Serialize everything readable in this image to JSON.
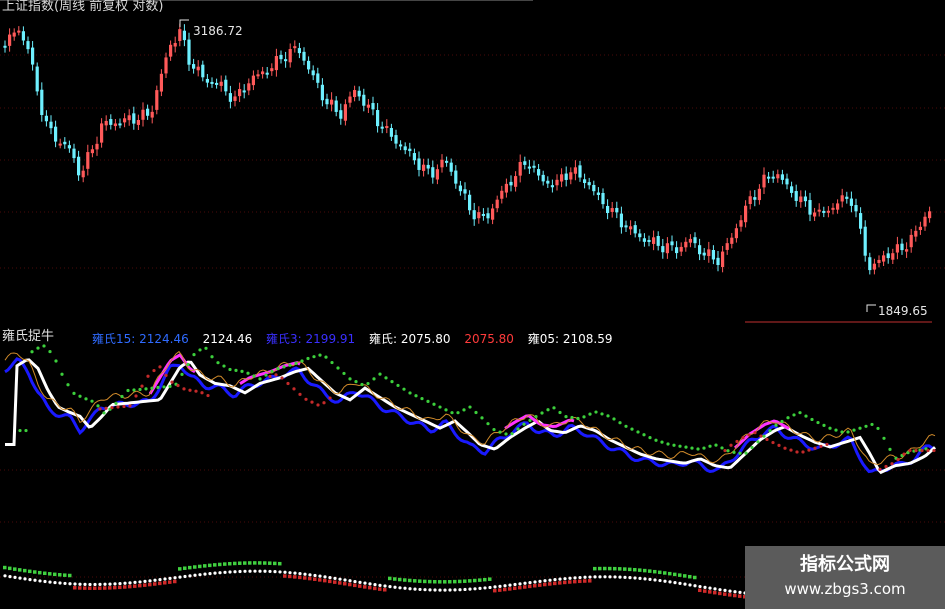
{
  "top_panel": {
    "title": "上证指数(周线 前复权 对数)",
    "high_label": "3186.72",
    "low_label": "1849.65"
  },
  "middle_panel": {
    "title": "雍氏捉牛",
    "legend": [
      {
        "text": "雍氏15: 2124.46",
        "color": "#2f6bff"
      },
      {
        "text": "2124.46",
        "color": "#ffffff"
      },
      {
        "text": "雍氏3: 2199.91",
        "color": "#3a2fff"
      },
      {
        "text": "雍氏: 2075.80",
        "color": "#ffffff"
      },
      {
        "text": "2075.80",
        "color": "#ff3b3b"
      },
      {
        "text": "雍05: 2108.59",
        "color": "#ffffff"
      }
    ]
  },
  "watermark": {
    "title": "指标公式网",
    "url": "www.zbgs3.com"
  },
  "colors": {
    "up_candle": "#ff5a5a",
    "down_candle": "#6ef0ff",
    "bg": "#000000"
  }
}
